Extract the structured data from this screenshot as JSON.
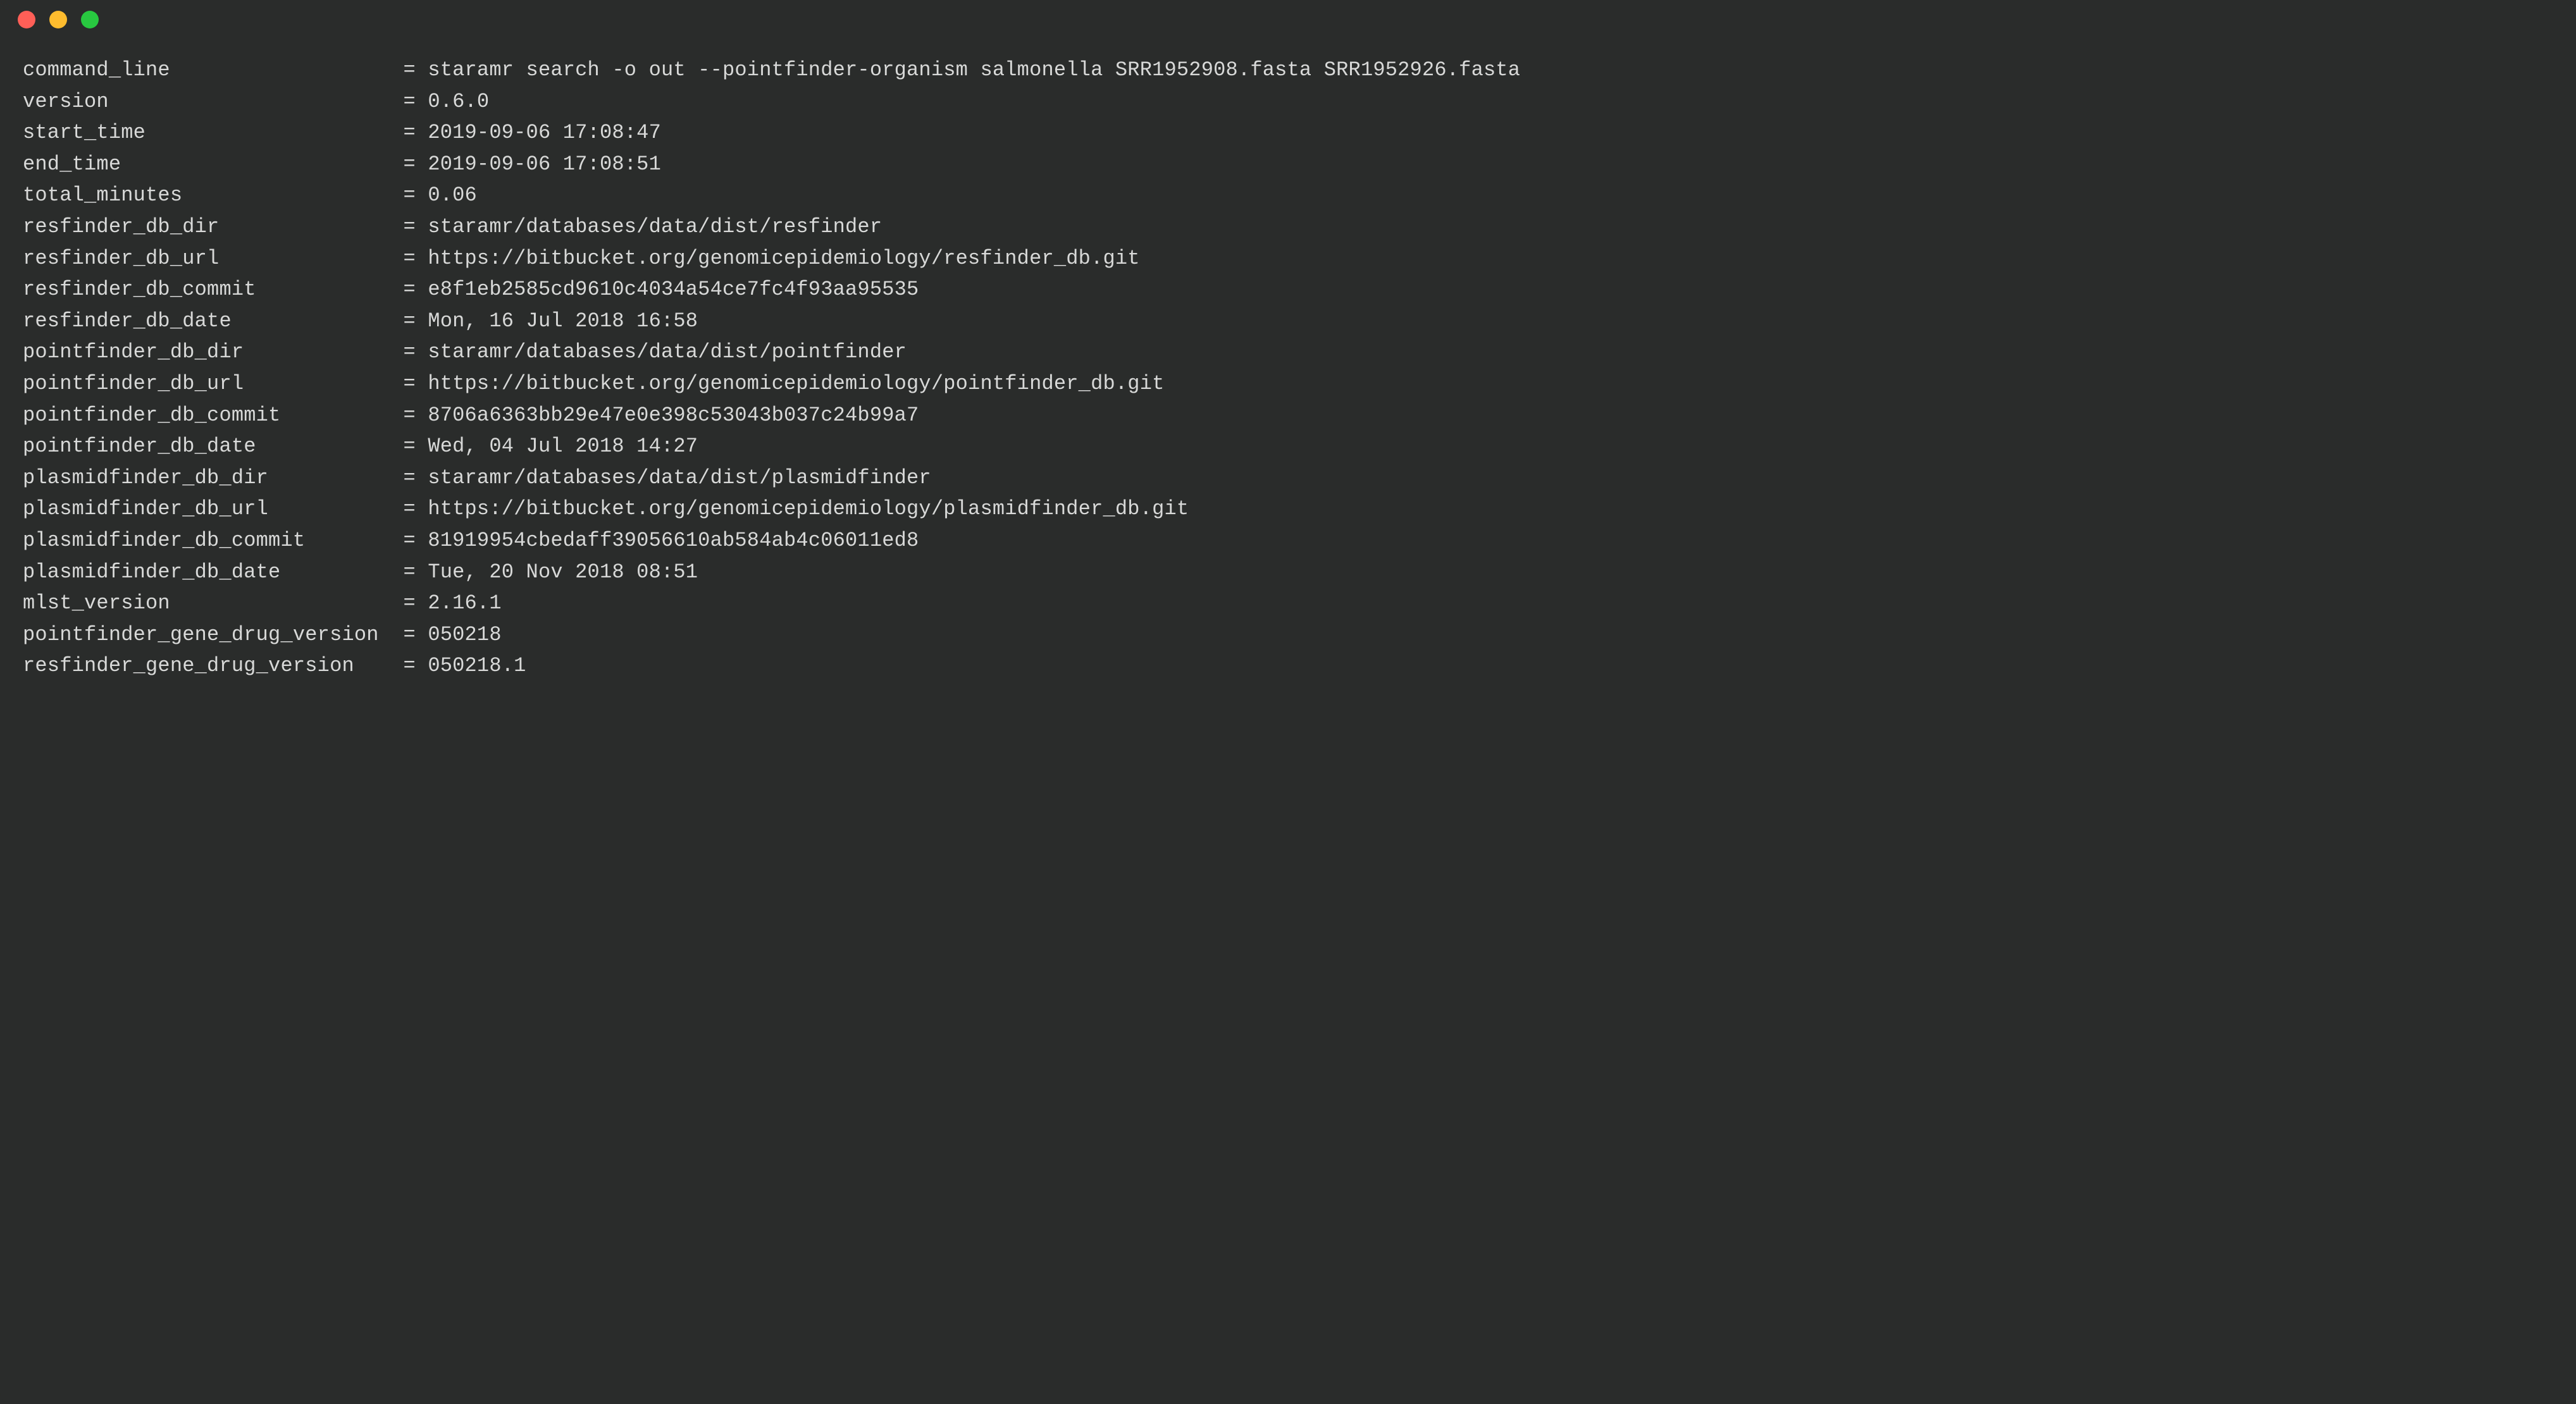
{
  "window": {
    "title": ""
  },
  "key_col_chars": 30,
  "rows": [
    {
      "key": "command_line",
      "value": "staramr search -o out --pointfinder-organism salmonella SRR1952908.fasta SRR1952926.fasta"
    },
    {
      "key": "version",
      "value": "0.6.0"
    },
    {
      "key": "start_time",
      "value": "2019-09-06 17:08:47"
    },
    {
      "key": "end_time",
      "value": "2019-09-06 17:08:51"
    },
    {
      "key": "total_minutes",
      "value": "0.06"
    },
    {
      "key": "resfinder_db_dir",
      "value": "staramr/databases/data/dist/resfinder"
    },
    {
      "key": "resfinder_db_url",
      "value": "https://bitbucket.org/genomicepidemiology/resfinder_db.git"
    },
    {
      "key": "resfinder_db_commit",
      "value": "e8f1eb2585cd9610c4034a54ce7fc4f93aa95535"
    },
    {
      "key": "resfinder_db_date",
      "value": "Mon, 16 Jul 2018 16:58"
    },
    {
      "key": "pointfinder_db_dir",
      "value": "staramr/databases/data/dist/pointfinder"
    },
    {
      "key": "pointfinder_db_url",
      "value": "https://bitbucket.org/genomicepidemiology/pointfinder_db.git"
    },
    {
      "key": "pointfinder_db_commit",
      "value": "8706a6363bb29e47e0e398c53043b037c24b99a7"
    },
    {
      "key": "pointfinder_db_date",
      "value": "Wed, 04 Jul 2018 14:27"
    },
    {
      "key": "plasmidfinder_db_dir",
      "value": "staramr/databases/data/dist/plasmidfinder"
    },
    {
      "key": "plasmidfinder_db_url",
      "value": "https://bitbucket.org/genomicepidemiology/plasmidfinder_db.git"
    },
    {
      "key": "plasmidfinder_db_commit",
      "value": "81919954cbedaff39056610ab584ab4c06011ed8"
    },
    {
      "key": "plasmidfinder_db_date",
      "value": "Tue, 20 Nov 2018 08:51"
    },
    {
      "key": "mlst_version",
      "value": "2.16.1"
    },
    {
      "key": "pointfinder_gene_drug_version",
      "value": "050218"
    },
    {
      "key": "resfinder_gene_drug_version",
      "value": "050218.1"
    }
  ]
}
